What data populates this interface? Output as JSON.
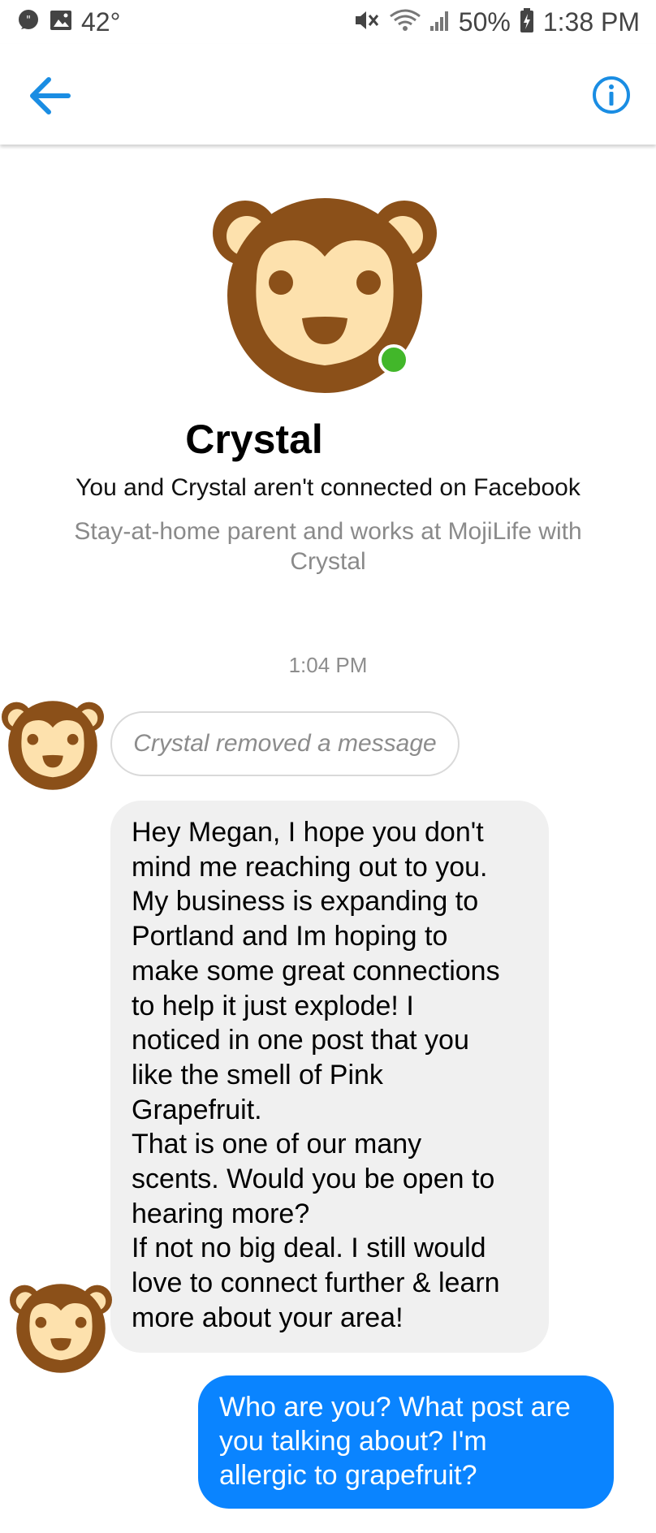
{
  "status_bar": {
    "temperature": "42°",
    "battery": "50%",
    "time": "1:38 PM"
  },
  "header": {
    "back_icon": "arrow-left-icon",
    "info_icon": "info-icon",
    "accent_color": "#1a8de3"
  },
  "profile": {
    "name": "Crystal",
    "connection_note": "You and Crystal aren't connected on Facebook",
    "details": "Stay-at-home parent and works at MojiLife with Crystal",
    "online_color": "#42b72a"
  },
  "conversation": {
    "timestamp": "1:04 PM",
    "removed_notice": "Crystal removed a message",
    "incoming_message": "Hey Megan, I hope you don't\nmind me reaching out to you.\nMy business is expanding to\nPortland and Im hoping to\nmake some great connections\nto help it just explode! I\nnoticed in one post that you\nlike the smell of Pink\nGrapefruit.\nThat is one of our many\nscents. Would you be open to\nhearing more?\nIf not no big deal. I still would\nlove to connect further & learn\nmore about your area!",
    "outgoing_message": "Who are you? What post are\nyou talking about? I'm\nallergic to grapefruit?",
    "incoming_bubble_color": "#f0f0f0",
    "outgoing_bubble_color": "#0a84ff"
  }
}
